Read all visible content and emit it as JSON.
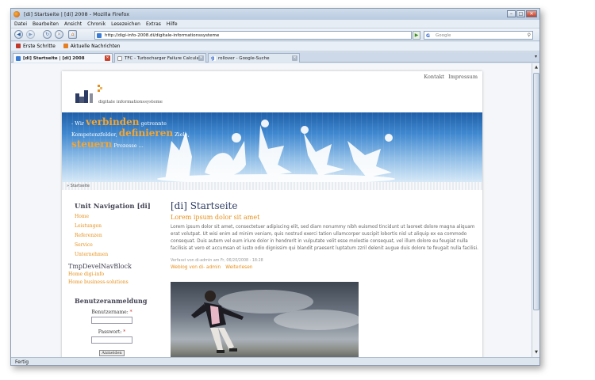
{
  "window": {
    "title": "[di] Startseite | [di] 2008 - Mozilla Firefox"
  },
  "menu": [
    "Datei",
    "Bearbeiten",
    "Ansicht",
    "Chronik",
    "Lesezeichen",
    "Extras",
    "Hilfe"
  ],
  "nav": {
    "url": "http://digi-info-2008.di/digitale-informationssysteme",
    "search_placeholder": "Google"
  },
  "bookmarks": [
    "Erste Schritte",
    "Aktuelle Nachrichten"
  ],
  "tabs": [
    {
      "label": "[di] Startseite | [di] 2008"
    },
    {
      "label": "TFC - Turbocharger Failure Calcula..."
    },
    {
      "label": "rollover - Google-Suche"
    }
  ],
  "status": "Fertig",
  "site": {
    "top_links": [
      "Kontakt",
      "Impressum"
    ],
    "logo_text": "digitale informationssysteme",
    "banner": {
      "line1_prefix": "- Wir",
      "line1_big": "verbinden",
      "line1_suffix": "getrennte",
      "line2_prefix": "Kompetenzfelder,",
      "line2_big": "definieren",
      "line2_suffix": "Ziele,",
      "line3_big": "steuern",
      "line3_suffix": "Prozesse ..."
    },
    "breadcrumb": "» Startseite",
    "unit_nav": {
      "title": "Unit Navigation [di]",
      "items": [
        "Home",
        "Leistungen",
        "Referenzen",
        "Service",
        "Unternehmen"
      ]
    },
    "devel": {
      "title": "TmpDevelNavBlock",
      "items": [
        "Home digi-info",
        "Home business-solutions"
      ]
    },
    "login": {
      "title": "Benutzeranmeldung",
      "user_label": "Benutzername:",
      "pass_label": "Passwort:",
      "required": "*",
      "submit": "Anmelden"
    },
    "article": {
      "title": "[di] Startseite",
      "subtitle": "Lorem ipsum dolor sit amet",
      "body": "Lorem ipsum dolor sit amet, consectetuer adipiscing elit, sed diam nonummy nibh euismod tincidunt ut laoreet dolore magna aliquam erat volutpat. Ut wisi enim ad minim veniam, quis nostrud exerci tation ullamcorper suscipit lobortis nisl ut aliquip ex ea commodo consequat. Duis autem vel eum iriure dolor in hendrerit in vulputate velit esse molestie consequat, vel illum dolore eu feugiat nulla facilisis at vero et accumsan et iusto odio dignissim qui blandit praesent luptatum zzril delenit augue duis dolore te feugait nulla facilisi.",
      "meta": "Verfasst von di-admin am Fr, 06/20/2008 - 18:28",
      "link_weblog": "Weblog von di- admin",
      "link_more": "Weiterlesen"
    }
  },
  "colors": {
    "accent": "#e58f1a",
    "heading": "#2d3c64",
    "banner_top": "#1f5fa8"
  }
}
